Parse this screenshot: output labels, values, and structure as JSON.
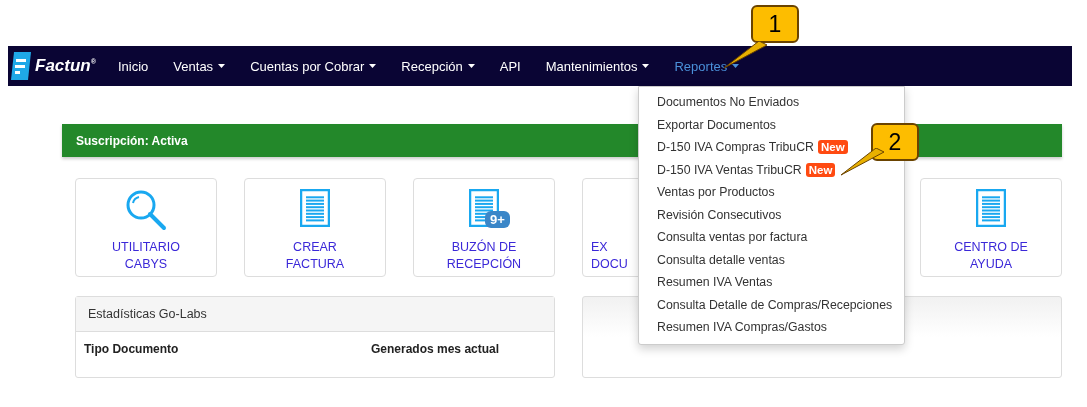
{
  "navbar": {
    "brand": "Factun",
    "brand_mark": "®",
    "items": [
      {
        "label": "Inicio",
        "dropdown": false,
        "selected": false
      },
      {
        "label": "Ventas",
        "dropdown": true,
        "selected": false
      },
      {
        "label": "Cuentas por Cobrar",
        "dropdown": true,
        "selected": false
      },
      {
        "label": "Recepción",
        "dropdown": true,
        "selected": false
      },
      {
        "label": "API",
        "dropdown": false,
        "selected": false
      },
      {
        "label": "Mantenimientos",
        "dropdown": true,
        "selected": false
      },
      {
        "label": "Reportes",
        "dropdown": true,
        "selected": true
      }
    ]
  },
  "reports_menu": {
    "items": [
      {
        "label": "Documentos No Enviados"
      },
      {
        "label": "Exportar Documentos"
      },
      {
        "label": "D-150 IVA Compras TribuCR",
        "badge": "New"
      },
      {
        "label": "D-150 IVA Ventas TribuCR",
        "badge": "New"
      },
      {
        "label": "Ventas por Productos"
      },
      {
        "label": "Revisión Consecutivos"
      },
      {
        "label": "Consulta ventas por factura"
      },
      {
        "label": "Consulta detalle ventas"
      },
      {
        "label": "Resumen IVA Ventas"
      },
      {
        "label": "Consulta Detalle de Compras/Recepciones"
      },
      {
        "label": "Resumen IVA Compras/Gastos"
      }
    ]
  },
  "subscription_bar": {
    "text": "Suscripción: Activa"
  },
  "shortcuts": [
    {
      "kind": "search",
      "lines": [
        "UTILITARIO",
        "CABYS"
      ]
    },
    {
      "kind": "document",
      "lines": [
        "CREAR",
        "FACTURA"
      ]
    },
    {
      "kind": "document",
      "lines": [
        "BUZÓN DE",
        "RECEPCIÓN"
      ],
      "badge": "9+"
    },
    {
      "kind": "partial",
      "lines": [
        "EX",
        "DOCU"
      ]
    },
    {
      "kind": "document",
      "lines": [
        "CENTRO DE",
        "AYUDA"
      ]
    }
  ],
  "stats_panel": {
    "title": "Estadísticas Go-Labs",
    "columns": [
      "Tipo Documento",
      "Generados mes actual"
    ]
  },
  "callouts": [
    {
      "label": "1"
    },
    {
      "label": "2"
    }
  ]
}
